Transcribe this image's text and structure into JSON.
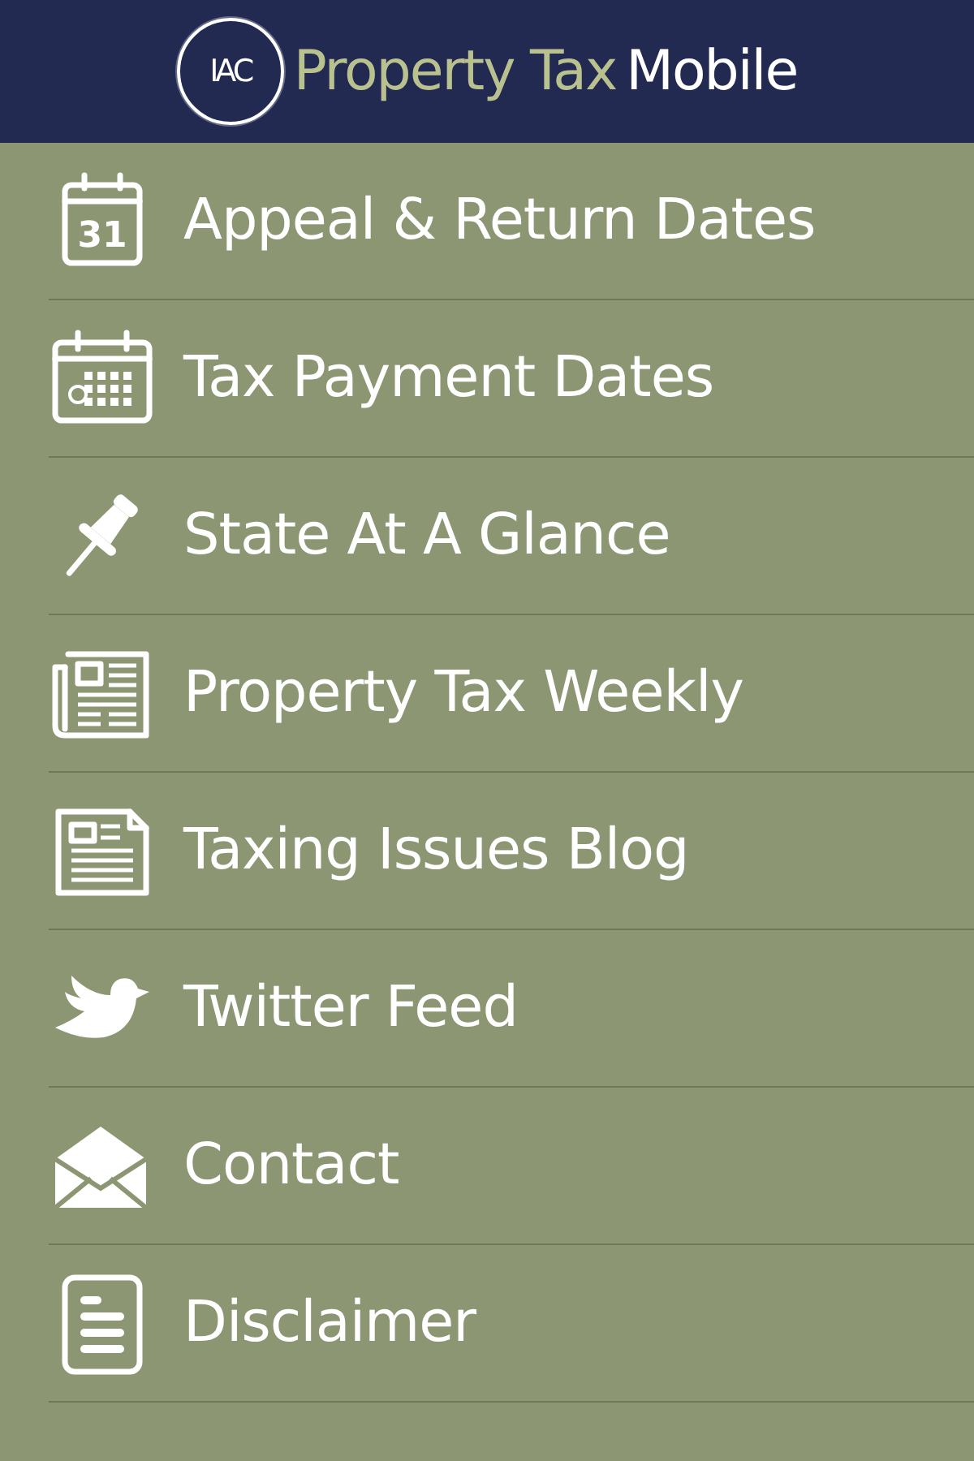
{
  "header": {
    "logo_mark": "IAC",
    "title_main": "Property Tax",
    "title_accent": "Mobile"
  },
  "menu": [
    {
      "label": "Appeal & Return Dates",
      "kind": "calendar-day",
      "icon_text": "31"
    },
    {
      "label": "Tax Payment Dates",
      "kind": "calendar-grid"
    },
    {
      "label": "State At A Glance",
      "kind": "pushpin"
    },
    {
      "label": "Property Tax Weekly",
      "kind": "newspaper"
    },
    {
      "label": "Taxing Issues Blog",
      "kind": "document"
    },
    {
      "label": "Twitter Feed",
      "kind": "bird"
    },
    {
      "label": "Contact",
      "kind": "envelope"
    },
    {
      "label": "Disclaimer",
      "kind": "notes"
    }
  ]
}
